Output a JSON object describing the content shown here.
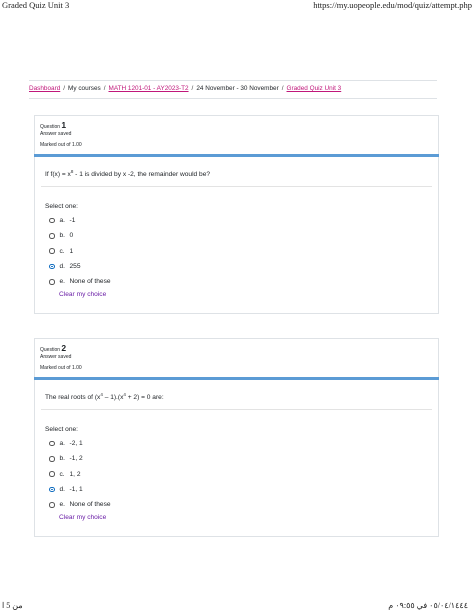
{
  "print_header": {
    "title": "Graded Quiz Unit 3",
    "url": "https://my.uopeople.edu/mod/quiz/attempt.php"
  },
  "breadcrumb": {
    "items": [
      "Dashboard",
      "My courses",
      "MATH 1201-01 - AY2023-T2",
      "24 November - 30 November",
      "Graded Quiz Unit 3"
    ],
    "separator": "/"
  },
  "questions": [
    {
      "label": "Question",
      "number": "1",
      "state": "Answer saved",
      "mark": "Marked out of 1.00",
      "text_pre": "If f(x) = x",
      "text_sup": "8",
      "text_post": " - 1 is divided by x -2, the remainder would be?",
      "select_label": "Select one:",
      "options": [
        {
          "letter": "a.",
          "text": "-1"
        },
        {
          "letter": "b.",
          "text": "0"
        },
        {
          "letter": "c.",
          "text": "1"
        },
        {
          "letter": "d.",
          "text": "255"
        },
        {
          "letter": "e.",
          "text": "None of these"
        }
      ],
      "selected_index": 3,
      "clear_label": "Clear my choice"
    },
    {
      "label": "Question",
      "number": "2",
      "state": "Answer saved",
      "mark": "Marked out of 1.00",
      "text_pre": "The real roots of (x",
      "text_sup": "4",
      "text_mid": " – 1).(x",
      "text_sup2": "4",
      "text_post": " + 2) = 0 are:",
      "select_label": "Select one:",
      "options": [
        {
          "letter": "a.",
          "text": "-2, 1"
        },
        {
          "letter": "b.",
          "text": "-1, 2"
        },
        {
          "letter": "c.",
          "text": "1, 2"
        },
        {
          "letter": "d.",
          "text": "-1, 1"
        },
        {
          "letter": "e.",
          "text": "None of these"
        }
      ],
      "selected_index": 3,
      "clear_label": "Clear my choice"
    }
  ],
  "print_footer": {
    "page": "من 5 ا",
    "datetime": "٠٥/٠٤/١٤٤٤ في ٠٩:٥٥ م"
  },
  "colors": {
    "link": "#c0177a",
    "accent_bar": "#5b9bd5",
    "radio_selected": "#0f6cbf",
    "clear_link": "#6a1ea6"
  }
}
